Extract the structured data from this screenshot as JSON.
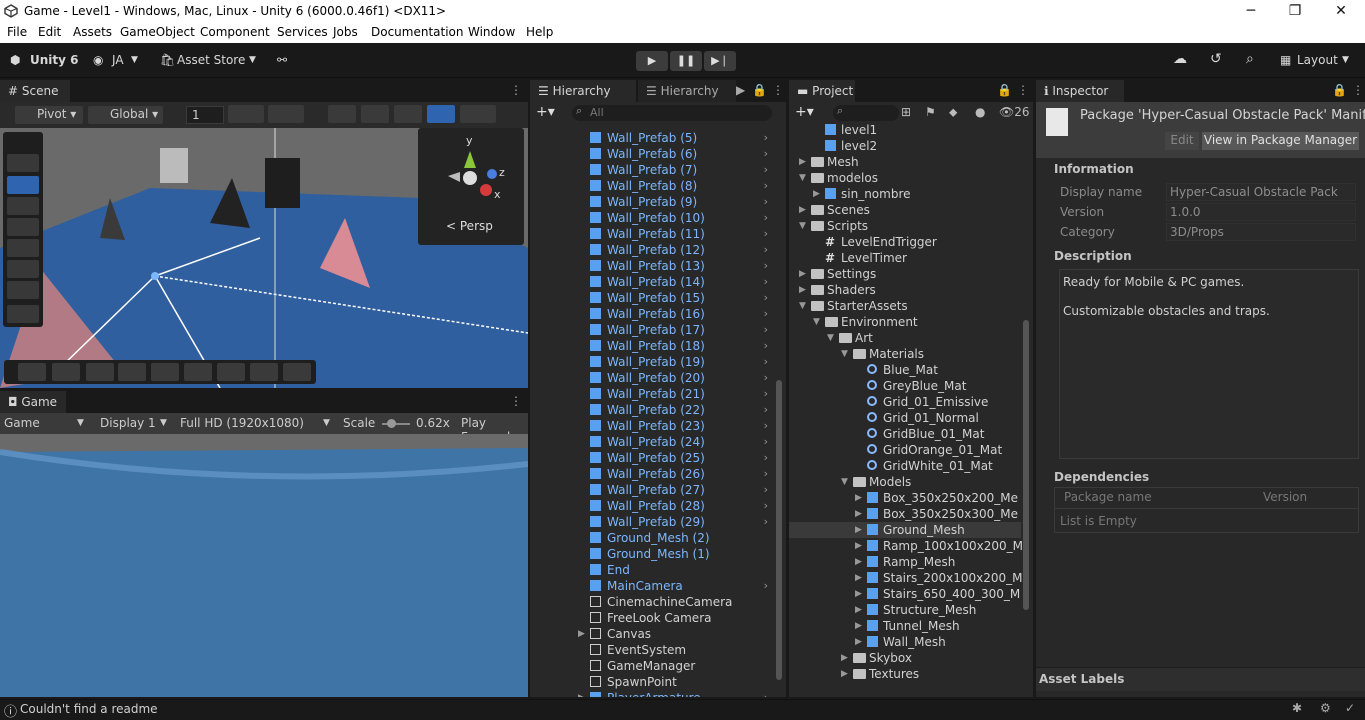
{
  "window": {
    "title": "Game - Level1 - Windows, Mac, Linux - Unity 6 (6000.0.46f1) <DX11>"
  },
  "menu": [
    "File",
    "Edit",
    "Assets",
    "GameObject",
    "Component",
    "Services",
    "Jobs",
    "Documentation",
    "Window",
    "Help"
  ],
  "toolbar": {
    "account_label": "Unity 6",
    "user_label": "JA",
    "asset_store_label": "Asset Store",
    "layout_label": "Layout"
  },
  "scene": {
    "tab_label": "Scene",
    "pivot_label": "Pivot",
    "global_label": "Global",
    "grid_value": "1",
    "persp_label": "Persp",
    "gizmo_axes": [
      "y",
      "z",
      "x"
    ]
  },
  "game": {
    "tab_label": "Game",
    "mode_label": "Game",
    "display_label": "Display 1",
    "resolution_label": "Full HD (1920x1080)",
    "scale_label": "Scale",
    "scale_value": "0.62x",
    "play_focused_label": "Play Focused"
  },
  "hierarchy": {
    "tab_label": "Hierarchy",
    "tab2_label": "Hierarchy",
    "search_placeholder": "All",
    "items": [
      {
        "label": "Wall_Prefab (5)",
        "color": "blue",
        "chev": true
      },
      {
        "label": "Wall_Prefab (6)",
        "color": "blue",
        "chev": true
      },
      {
        "label": "Wall_Prefab (7)",
        "color": "blue",
        "chev": true
      },
      {
        "label": "Wall_Prefab (8)",
        "color": "blue",
        "chev": true
      },
      {
        "label": "Wall_Prefab (9)",
        "color": "blue",
        "chev": true
      },
      {
        "label": "Wall_Prefab (10)",
        "color": "blue",
        "chev": true
      },
      {
        "label": "Wall_Prefab (11)",
        "color": "blue",
        "chev": true
      },
      {
        "label": "Wall_Prefab (12)",
        "color": "blue",
        "chev": true
      },
      {
        "label": "Wall_Prefab (13)",
        "color": "blue",
        "chev": true
      },
      {
        "label": "Wall_Prefab (14)",
        "color": "blue",
        "chev": true
      },
      {
        "label": "Wall_Prefab (15)",
        "color": "blue",
        "chev": true
      },
      {
        "label": "Wall_Prefab (16)",
        "color": "blue",
        "chev": true
      },
      {
        "label": "Wall_Prefab (17)",
        "color": "blue",
        "chev": true
      },
      {
        "label": "Wall_Prefab (18)",
        "color": "blue",
        "chev": true
      },
      {
        "label": "Wall_Prefab (19)",
        "color": "blue",
        "chev": true
      },
      {
        "label": "Wall_Prefab (20)",
        "color": "blue",
        "chev": true
      },
      {
        "label": "Wall_Prefab (21)",
        "color": "blue",
        "chev": true
      },
      {
        "label": "Wall_Prefab (22)",
        "color": "blue",
        "chev": true
      },
      {
        "label": "Wall_Prefab (23)",
        "color": "blue",
        "chev": true
      },
      {
        "label": "Wall_Prefab (24)",
        "color": "blue",
        "chev": true
      },
      {
        "label": "Wall_Prefab (25)",
        "color": "blue",
        "chev": true
      },
      {
        "label": "Wall_Prefab (26)",
        "color": "blue",
        "chev": true
      },
      {
        "label": "Wall_Prefab (27)",
        "color": "blue",
        "chev": true
      },
      {
        "label": "Wall_Prefab (28)",
        "color": "blue",
        "chev": true
      },
      {
        "label": "Wall_Prefab (29)",
        "color": "blue",
        "chev": true
      },
      {
        "label": "Ground_Mesh (2)",
        "color": "blue",
        "chev": false
      },
      {
        "label": "Ground_Mesh (1)",
        "color": "blue",
        "chev": false
      },
      {
        "label": "End",
        "color": "blue",
        "chev": false
      },
      {
        "label": "MainCamera",
        "color": "blue",
        "chev": true
      },
      {
        "label": "CinemachineCamera",
        "color": "white",
        "chev": false
      },
      {
        "label": "FreeLook Camera",
        "color": "white",
        "chev": false
      },
      {
        "label": "Canvas",
        "color": "white",
        "chev": false,
        "expand": true
      },
      {
        "label": "EventSystem",
        "color": "white",
        "chev": false
      },
      {
        "label": "GameManager",
        "color": "white",
        "chev": false
      },
      {
        "label": "SpawnPoint",
        "color": "white",
        "chev": false
      },
      {
        "label": "PlayerArmature",
        "color": "blue",
        "chev": true,
        "expand": true
      }
    ]
  },
  "project": {
    "tab_label": "Project",
    "hidden_count": "26",
    "items": [
      {
        "label": "level1",
        "depth": 2,
        "icon": "unity",
        "arrow": ""
      },
      {
        "label": "level2",
        "depth": 2,
        "icon": "unity",
        "arrow": ""
      },
      {
        "label": "Mesh",
        "depth": 1,
        "icon": "folder",
        "arrow": "▶"
      },
      {
        "label": "modelos",
        "depth": 1,
        "icon": "folder",
        "arrow": "▼"
      },
      {
        "label": "sin_nombre",
        "depth": 2,
        "icon": "cube",
        "arrow": "▶"
      },
      {
        "label": "Scenes",
        "depth": 1,
        "icon": "folder",
        "arrow": "▶"
      },
      {
        "label": "Scripts",
        "depth": 1,
        "icon": "folder",
        "arrow": "▼"
      },
      {
        "label": "LevelEndTrigger",
        "depth": 2,
        "icon": "script",
        "arrow": ""
      },
      {
        "label": "LevelTimer",
        "depth": 2,
        "icon": "script",
        "arrow": ""
      },
      {
        "label": "Settings",
        "depth": 1,
        "icon": "folder",
        "arrow": "▶"
      },
      {
        "label": "Shaders",
        "depth": 1,
        "icon": "folder",
        "arrow": "▶"
      },
      {
        "label": "StarterAssets",
        "depth": 1,
        "icon": "folder",
        "arrow": "▼"
      },
      {
        "label": "Environment",
        "depth": 2,
        "icon": "folder",
        "arrow": "▼"
      },
      {
        "label": "Art",
        "depth": 3,
        "icon": "folder",
        "arrow": "▼"
      },
      {
        "label": "Materials",
        "depth": 4,
        "icon": "folder",
        "arrow": "▼"
      },
      {
        "label": "Blue_Mat",
        "depth": 5,
        "icon": "mat",
        "arrow": ""
      },
      {
        "label": "GreyBlue_Mat",
        "depth": 5,
        "icon": "mat",
        "arrow": ""
      },
      {
        "label": "Grid_01_Emissive",
        "depth": 5,
        "icon": "mat",
        "arrow": ""
      },
      {
        "label": "Grid_01_Normal",
        "depth": 5,
        "icon": "mat",
        "arrow": ""
      },
      {
        "label": "GridBlue_01_Mat",
        "depth": 5,
        "icon": "mat",
        "arrow": ""
      },
      {
        "label": "GridOrange_01_Mat",
        "depth": 5,
        "icon": "mat",
        "arrow": ""
      },
      {
        "label": "GridWhite_01_Mat",
        "depth": 5,
        "icon": "mat",
        "arrow": ""
      },
      {
        "label": "Models",
        "depth": 4,
        "icon": "folder",
        "arrow": "▼"
      },
      {
        "label": "Box_350x250x200_Me",
        "depth": 5,
        "icon": "cube",
        "arrow": "▶"
      },
      {
        "label": "Box_350x250x300_Me",
        "depth": 5,
        "icon": "cube",
        "arrow": "▶"
      },
      {
        "label": "Ground_Mesh",
        "depth": 5,
        "icon": "cube",
        "arrow": "▶",
        "selected": true
      },
      {
        "label": "Ramp_100x100x200_M",
        "depth": 5,
        "icon": "cube",
        "arrow": "▶"
      },
      {
        "label": "Ramp_Mesh",
        "depth": 5,
        "icon": "cube",
        "arrow": "▶"
      },
      {
        "label": "Stairs_200x100x200_M",
        "depth": 5,
        "icon": "cube",
        "arrow": "▶"
      },
      {
        "label": "Stairs_650_400_300_M",
        "depth": 5,
        "icon": "cube",
        "arrow": "▶"
      },
      {
        "label": "Structure_Mesh",
        "depth": 5,
        "icon": "cube",
        "arrow": "▶"
      },
      {
        "label": "Tunnel_Mesh",
        "depth": 5,
        "icon": "cube",
        "arrow": "▶"
      },
      {
        "label": "Wall_Mesh",
        "depth": 5,
        "icon": "cube",
        "arrow": "▶"
      },
      {
        "label": "Skybox",
        "depth": 4,
        "icon": "folder",
        "arrow": "▶"
      },
      {
        "label": "Textures",
        "depth": 4,
        "icon": "folder",
        "arrow": "▶"
      }
    ]
  },
  "inspector": {
    "tab_label": "Inspector",
    "title": "Package 'Hyper-Casual Obstacle Pack' Manife",
    "edit_label": "Edit",
    "view_pm_label": "View in Package Manager",
    "info_header": "Information",
    "fields": [
      {
        "label": "Display name",
        "value": "Hyper-Casual Obstacle Pack"
      },
      {
        "label": "Version",
        "value": "1.0.0"
      },
      {
        "label": "Category",
        "value": "3D/Props"
      }
    ],
    "description_header": "Description",
    "description_lines": [
      "Ready for Mobile & PC games.",
      "",
      "Customizable obstacles and traps."
    ],
    "dependencies_header": "Dependencies",
    "dep_col1": "Package name",
    "dep_col2": "Version",
    "dep_empty": "List is Empty",
    "asset_labels": "Asset Labels"
  },
  "status": {
    "message": "Couldn't find a readme"
  },
  "colors": {
    "accent": "#2f65b0",
    "link_blue": "#7cb6ff",
    "panel_bg": "#282828",
    "dark_bg": "#191919"
  }
}
